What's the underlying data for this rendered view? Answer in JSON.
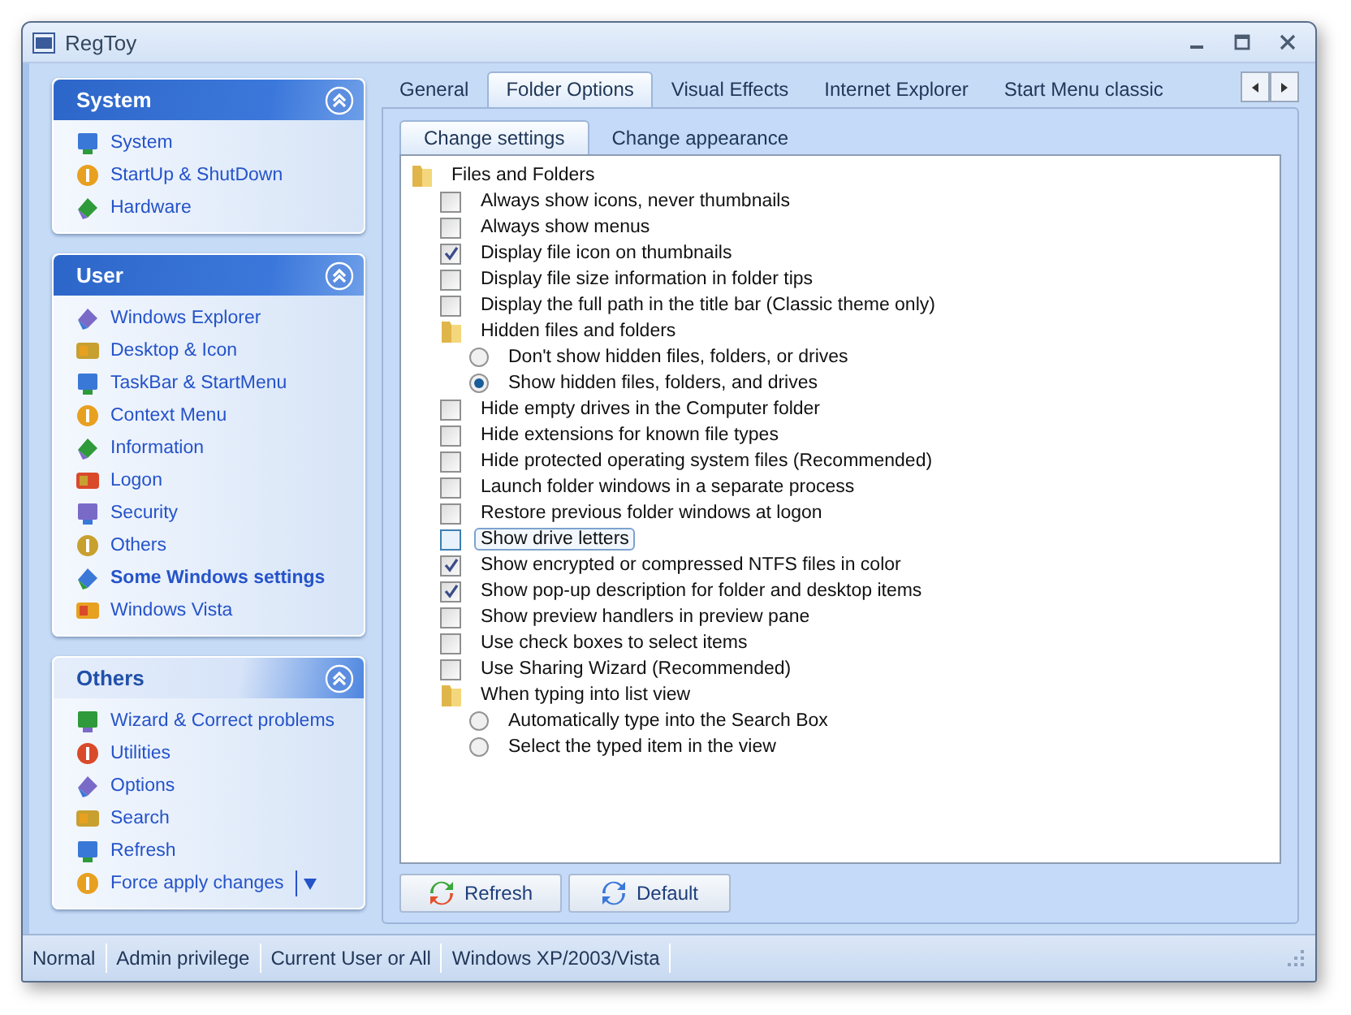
{
  "window": {
    "title": "RegToy"
  },
  "sidebar": {
    "groups": [
      {
        "title": "System",
        "highlighted": true,
        "expanded": true,
        "items": [
          {
            "label": "System",
            "selected": false,
            "kind": "link"
          },
          {
            "label": "StartUp & ShutDown",
            "selected": false,
            "kind": "link"
          },
          {
            "label": "Hardware",
            "selected": false,
            "kind": "link"
          }
        ]
      },
      {
        "title": "User",
        "highlighted": true,
        "expanded": true,
        "items": [
          {
            "label": "Windows Explorer",
            "selected": false,
            "kind": "link"
          },
          {
            "label": "Desktop & Icon",
            "selected": false,
            "kind": "link"
          },
          {
            "label": "TaskBar & StartMenu",
            "selected": false,
            "kind": "link"
          },
          {
            "label": "Context Menu",
            "selected": false,
            "kind": "link"
          },
          {
            "label": "Information",
            "selected": false,
            "kind": "link"
          },
          {
            "label": "Logon",
            "selected": false,
            "kind": "link"
          },
          {
            "label": "Security",
            "selected": false,
            "kind": "link"
          },
          {
            "label": "Others",
            "selected": false,
            "kind": "link"
          },
          {
            "label": "Some Windows settings",
            "selected": true,
            "kind": "link"
          },
          {
            "label": "Windows Vista",
            "selected": false,
            "kind": "link"
          }
        ]
      },
      {
        "title": "Others",
        "highlighted": false,
        "expanded": true,
        "items": [
          {
            "label": "Wizard & Correct problems",
            "selected": false,
            "kind": "link"
          },
          {
            "label": "Utilities",
            "selected": false,
            "kind": "link"
          },
          {
            "label": "Options",
            "selected": false,
            "kind": "link"
          },
          {
            "label": "Search",
            "selected": false,
            "kind": "link"
          },
          {
            "label": "Refresh",
            "selected": false,
            "kind": "link"
          },
          {
            "label": "Force apply changes",
            "selected": false,
            "kind": "split"
          }
        ]
      }
    ]
  },
  "tabs": [
    {
      "label": "General",
      "selected": false
    },
    {
      "label": "Folder Options",
      "selected": true
    },
    {
      "label": "Visual Effects",
      "selected": false
    },
    {
      "label": "Internet Explorer",
      "selected": false
    },
    {
      "label": "Start Menu classic",
      "selected": false
    }
  ],
  "subtabs": [
    {
      "label": "Change settings",
      "selected": true
    },
    {
      "label": "Change appearance",
      "selected": false
    }
  ],
  "tree": [
    {
      "kind": "folder",
      "label": "Files and Folders",
      "children": [
        {
          "kind": "checkbox",
          "label": "Always show icons, never thumbnails",
          "checked": false,
          "focused": false
        },
        {
          "kind": "checkbox",
          "label": "Always show menus",
          "checked": false,
          "focused": false
        },
        {
          "kind": "checkbox",
          "label": "Display file icon on thumbnails",
          "checked": true,
          "focused": false
        },
        {
          "kind": "checkbox",
          "label": "Display file size information in folder tips",
          "checked": false,
          "focused": false
        },
        {
          "kind": "checkbox",
          "label": "Display the full path in the title bar (Classic theme only)",
          "checked": false,
          "focused": false
        },
        {
          "kind": "folder",
          "label": "Hidden files and folders",
          "children": [
            {
              "kind": "radio",
              "label": "Don't show hidden files, folders, or drives",
              "selected": false
            },
            {
              "kind": "radio",
              "label": "Show hidden files, folders, and drives",
              "selected": true
            }
          ]
        },
        {
          "kind": "checkbox",
          "label": "Hide empty drives in the Computer folder",
          "checked": false,
          "focused": false
        },
        {
          "kind": "checkbox",
          "label": "Hide extensions for known file types",
          "checked": false,
          "focused": false
        },
        {
          "kind": "checkbox",
          "label": "Hide protected operating system files (Recommended)",
          "checked": false,
          "focused": false
        },
        {
          "kind": "checkbox",
          "label": "Launch folder windows in a separate process",
          "checked": false,
          "focused": false
        },
        {
          "kind": "checkbox",
          "label": "Restore previous folder windows at logon",
          "checked": false,
          "focused": false
        },
        {
          "kind": "checkbox",
          "label": "Show drive letters",
          "checked": false,
          "focused": true
        },
        {
          "kind": "checkbox",
          "label": "Show encrypted or compressed NTFS files in color",
          "checked": true,
          "focused": false
        },
        {
          "kind": "checkbox",
          "label": "Show pop-up description for folder and desktop items",
          "checked": true,
          "focused": false
        },
        {
          "kind": "checkbox",
          "label": "Show preview handlers in preview pane",
          "checked": false,
          "focused": false
        },
        {
          "kind": "checkbox",
          "label": "Use check boxes to select items",
          "checked": false,
          "focused": false
        },
        {
          "kind": "checkbox",
          "label": "Use Sharing Wizard (Recommended)",
          "checked": false,
          "focused": false
        },
        {
          "kind": "folder",
          "label": "When typing into list view",
          "children": [
            {
              "kind": "radio",
              "label": "Automatically type into the Search Box",
              "selected": false
            },
            {
              "kind": "radio",
              "label": "Select the typed item in the view",
              "selected": false
            }
          ]
        }
      ]
    }
  ],
  "buttons": [
    {
      "label": "Refresh",
      "kind": "refresh"
    },
    {
      "label": "Default",
      "kind": "default"
    }
  ],
  "status_bar": [
    "Normal",
    "Admin privilege",
    "Current User or All",
    "Windows XP/2003/Vista"
  ]
}
